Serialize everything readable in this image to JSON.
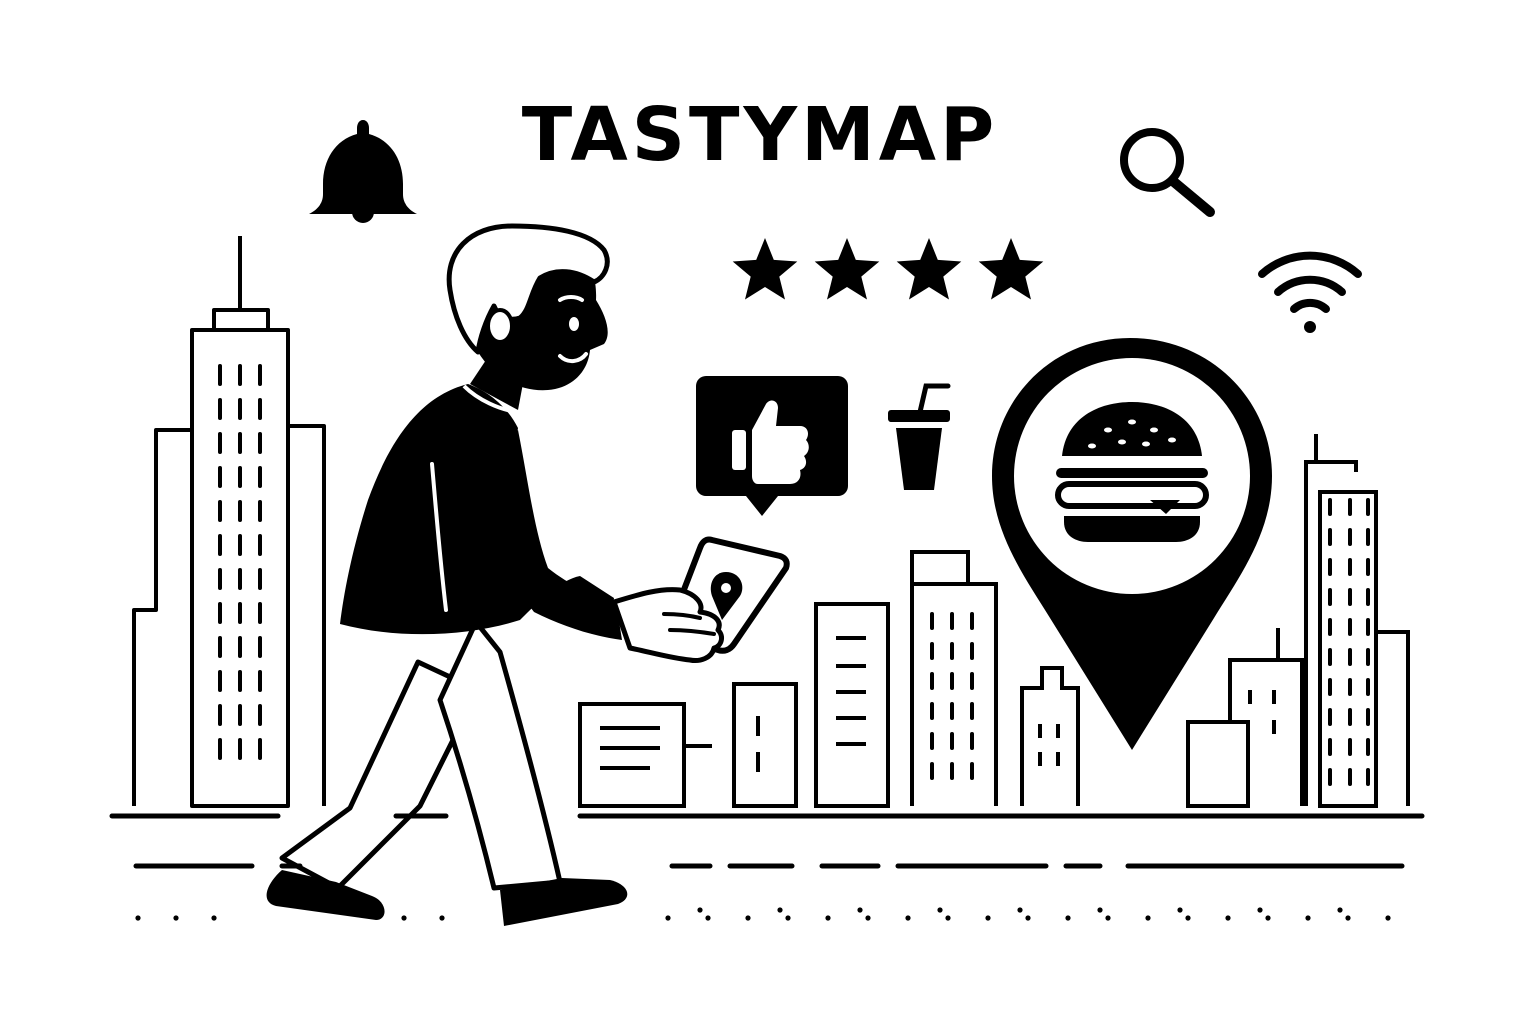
{
  "app": {
    "title": "TASTYMAP"
  },
  "icons": {
    "notification": "bell-icon",
    "search": "search-icon",
    "wifi": "wifi-icon",
    "like": "thumbs-up-icon",
    "drink": "drink-cup-icon",
    "location": "map-pin-icon",
    "food": "burger-icon"
  },
  "rating": {
    "stars": 4,
    "max_shown": 4
  },
  "colors": {
    "ink": "#000000",
    "paper": "#ffffff"
  }
}
